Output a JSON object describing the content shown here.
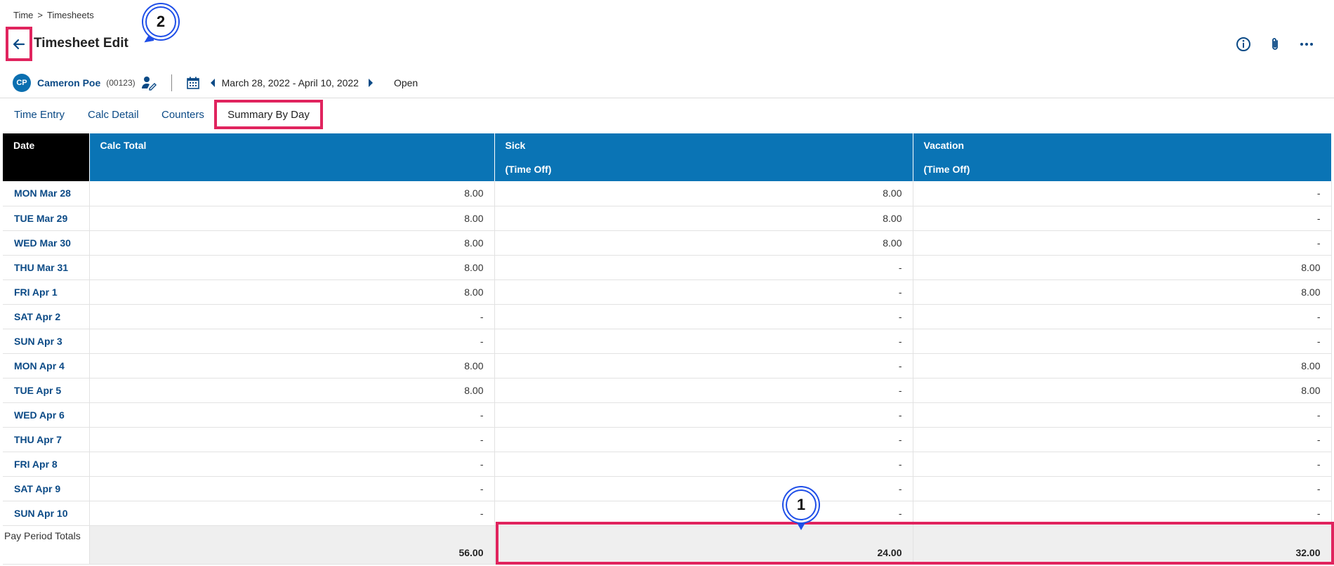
{
  "breadcrumb": {
    "parent": "Time",
    "separator": ">",
    "current": "Timesheets"
  },
  "page_title": "Timesheet Edit",
  "annotations": {
    "one": "1",
    "two": "2"
  },
  "employee": {
    "initials": "CP",
    "name": "Cameron Poe",
    "id": "(00123)"
  },
  "period": {
    "range": "March 28, 2022 - April 10, 2022",
    "status": "Open"
  },
  "tabs": [
    "Time Entry",
    "Calc Detail",
    "Counters",
    "Summary By Day"
  ],
  "active_tab": "Summary By Day",
  "table": {
    "headers": {
      "date": "Date",
      "calc_total": "Calc Total",
      "sick": "Sick",
      "sick_sub": "(Time Off)",
      "vacation": "Vacation",
      "vacation_sub": "(Time Off)"
    },
    "rows": [
      {
        "date": "MON Mar 28",
        "calc": "8.00",
        "sick": "8.00",
        "vac": "-"
      },
      {
        "date": "TUE Mar 29",
        "calc": "8.00",
        "sick": "8.00",
        "vac": "-"
      },
      {
        "date": "WED Mar 30",
        "calc": "8.00",
        "sick": "8.00",
        "vac": "-"
      },
      {
        "date": "THU Mar 31",
        "calc": "8.00",
        "sick": "-",
        "vac": "8.00"
      },
      {
        "date": "FRI Apr 1",
        "calc": "8.00",
        "sick": "-",
        "vac": "8.00"
      },
      {
        "date": "SAT Apr 2",
        "calc": "-",
        "sick": "-",
        "vac": "-"
      },
      {
        "date": "SUN Apr 3",
        "calc": "-",
        "sick": "-",
        "vac": "-"
      },
      {
        "date": "MON Apr 4",
        "calc": "8.00",
        "sick": "-",
        "vac": "8.00"
      },
      {
        "date": "TUE Apr 5",
        "calc": "8.00",
        "sick": "-",
        "vac": "8.00"
      },
      {
        "date": "WED Apr 6",
        "calc": "-",
        "sick": "-",
        "vac": "-"
      },
      {
        "date": "THU Apr 7",
        "calc": "-",
        "sick": "-",
        "vac": "-"
      },
      {
        "date": "FRI Apr 8",
        "calc": "-",
        "sick": "-",
        "vac": "-"
      },
      {
        "date": "SAT Apr 9",
        "calc": "-",
        "sick": "-",
        "vac": "-"
      },
      {
        "date": "SUN Apr 10",
        "calc": "-",
        "sick": "-",
        "vac": "-"
      }
    ],
    "totals": {
      "label": "Pay Period Totals",
      "calc": "56.00",
      "sick": "24.00",
      "vac": "32.00"
    }
  },
  "icons": {
    "back": "arrow-left-icon",
    "info": "info-icon",
    "attach": "paperclip-icon",
    "more": "more-horizontal-icon",
    "user_edit": "user-edit-icon",
    "calendar": "calendar-icon",
    "prev": "caret-left-icon",
    "next": "caret-right-icon"
  },
  "colors": {
    "header_blue": "#0a74b5",
    "link_blue": "#0b4a86",
    "highlight": "#e0245e",
    "callout": "#1f4fe8"
  }
}
